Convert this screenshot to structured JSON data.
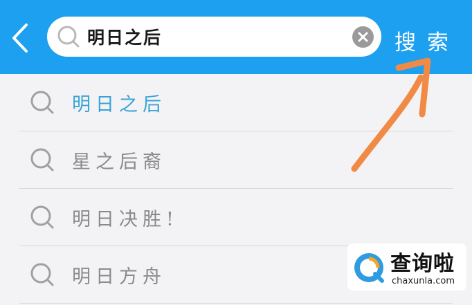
{
  "header": {
    "search_query": "明日之后",
    "search_action_label": "搜索"
  },
  "suggestions": [
    {
      "text": "明日之后",
      "highlighted": true
    },
    {
      "text": "星之后裔",
      "highlighted": false
    },
    {
      "text": "明日决胜!",
      "highlighted": false
    },
    {
      "text": "明日方舟",
      "highlighted": false
    }
  ],
  "watermark": {
    "title": "查询啦",
    "url": "chaxunla.com"
  },
  "icons": {
    "back": "chevron-left-icon",
    "search": "search-icon",
    "clear": "clear-icon",
    "annotation": "annotation-arrow-icon"
  },
  "colors": {
    "header_bg": "#1da0f0",
    "highlight_text": "#3aa2d6",
    "muted_text": "#8a8a8a",
    "annotation_arrow": "#f08a45",
    "page_bg": "#f3f3f5"
  }
}
